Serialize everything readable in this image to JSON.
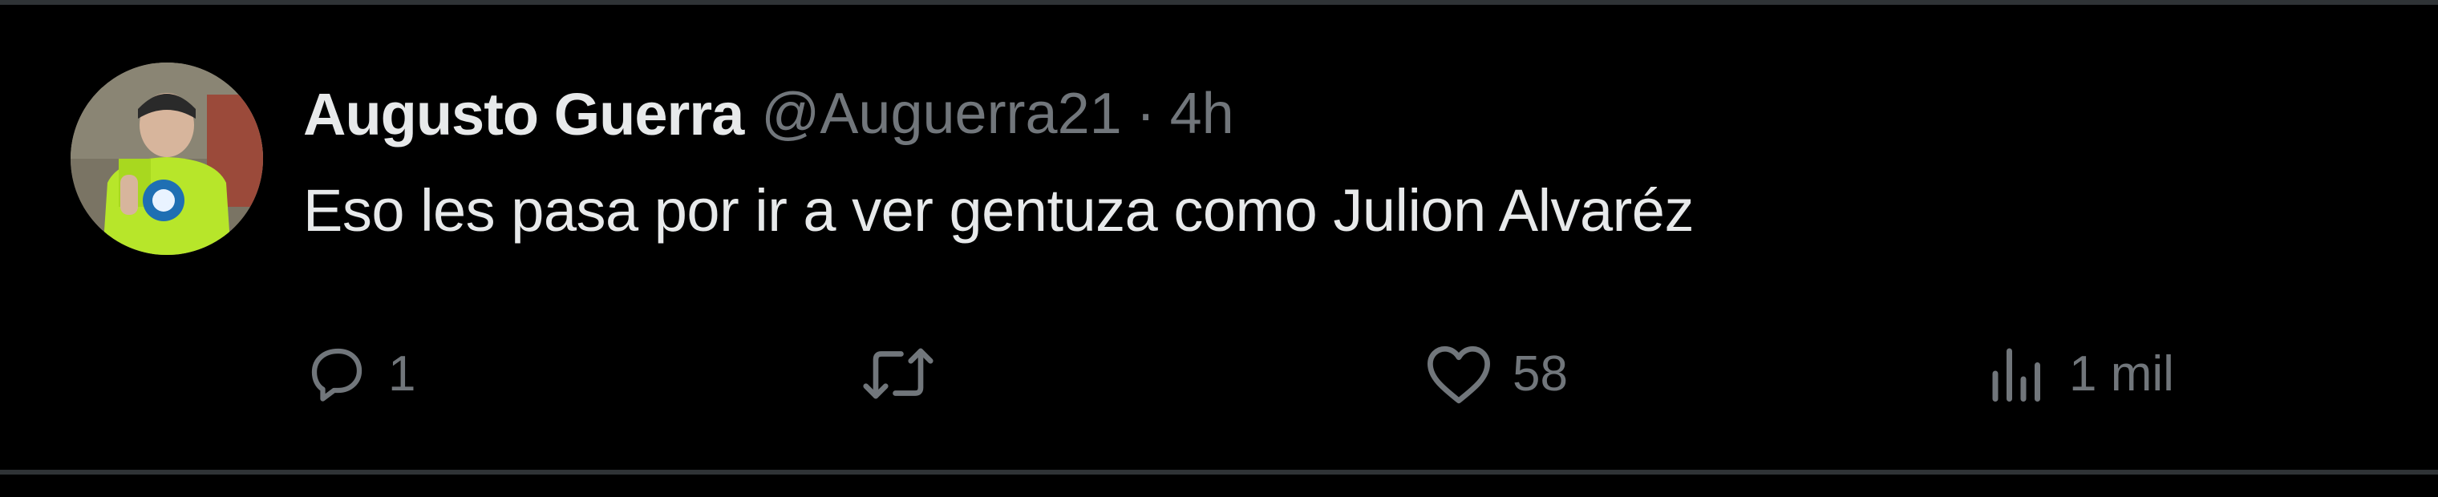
{
  "tweet": {
    "author": {
      "display_name": "Augusto Guerra",
      "handle": "@Auguerra21"
    },
    "separator": "·",
    "time_ago": "4h",
    "text": "Eso les pasa por ir a ver gentuza como Julion Alvaréz",
    "actions": {
      "reply": {
        "icon": "reply-icon",
        "count": "1"
      },
      "retweet": {
        "icon": "retweet-icon",
        "count": ""
      },
      "like": {
        "icon": "heart-icon",
        "count": "58"
      },
      "views": {
        "icon": "views-chart-icon",
        "count": "1 mil"
      }
    }
  },
  "colors": {
    "background": "#000000",
    "primary_text": "#e7e9ea",
    "secondary_text": "#71767b",
    "border": "#2f3336"
  }
}
